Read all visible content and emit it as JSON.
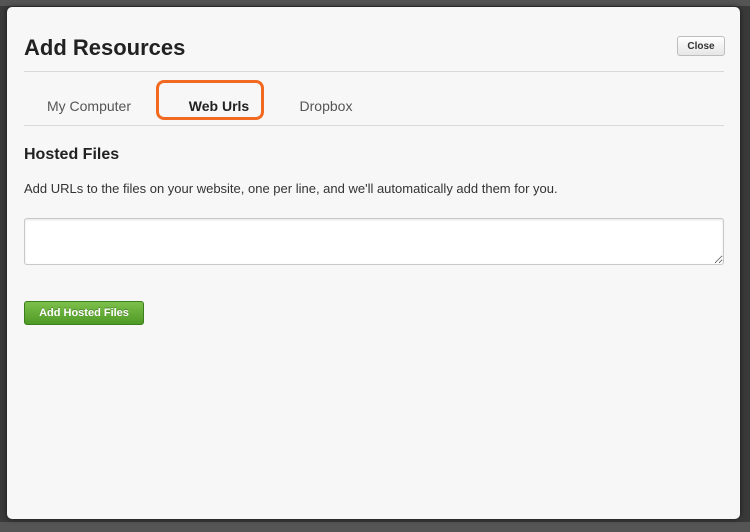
{
  "modal": {
    "title": "Add Resources",
    "close_label": "Close"
  },
  "tabs": [
    {
      "label": "My Computer",
      "active": false
    },
    {
      "label": "Web Urls",
      "active": true
    },
    {
      "label": "Dropbox",
      "active": false
    }
  ],
  "hosted_files": {
    "title": "Hosted Files",
    "description": "Add URLs to the files on your website, one per line, and we'll automatically add them for you.",
    "textarea_value": "",
    "add_button_label": "Add Hosted Files"
  },
  "colors": {
    "highlight": "#f26a21",
    "add_button": "#5ea832"
  }
}
